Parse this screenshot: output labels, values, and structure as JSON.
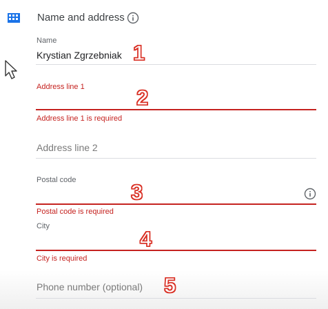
{
  "section": {
    "title": "Name and address",
    "icon": "building-icon",
    "info_icon": "info-icon"
  },
  "fields": {
    "name": {
      "label": "Name",
      "value": "Krystian Zgrzebniak"
    },
    "address1": {
      "label": "Address line 1",
      "error": "Address line 1 is required"
    },
    "address2": {
      "placeholder": "Address line 2"
    },
    "postal": {
      "label": "Postal code",
      "error": "Postal code is required"
    },
    "city": {
      "label": "City",
      "error": "City is required"
    },
    "phone": {
      "placeholder": "Phone number (optional)"
    }
  },
  "annotations": [
    "1",
    "2",
    "3",
    "4",
    "5"
  ],
  "colors": {
    "error": "#c5221f",
    "accent": "#1a73e8",
    "annotation": "#d93025"
  }
}
